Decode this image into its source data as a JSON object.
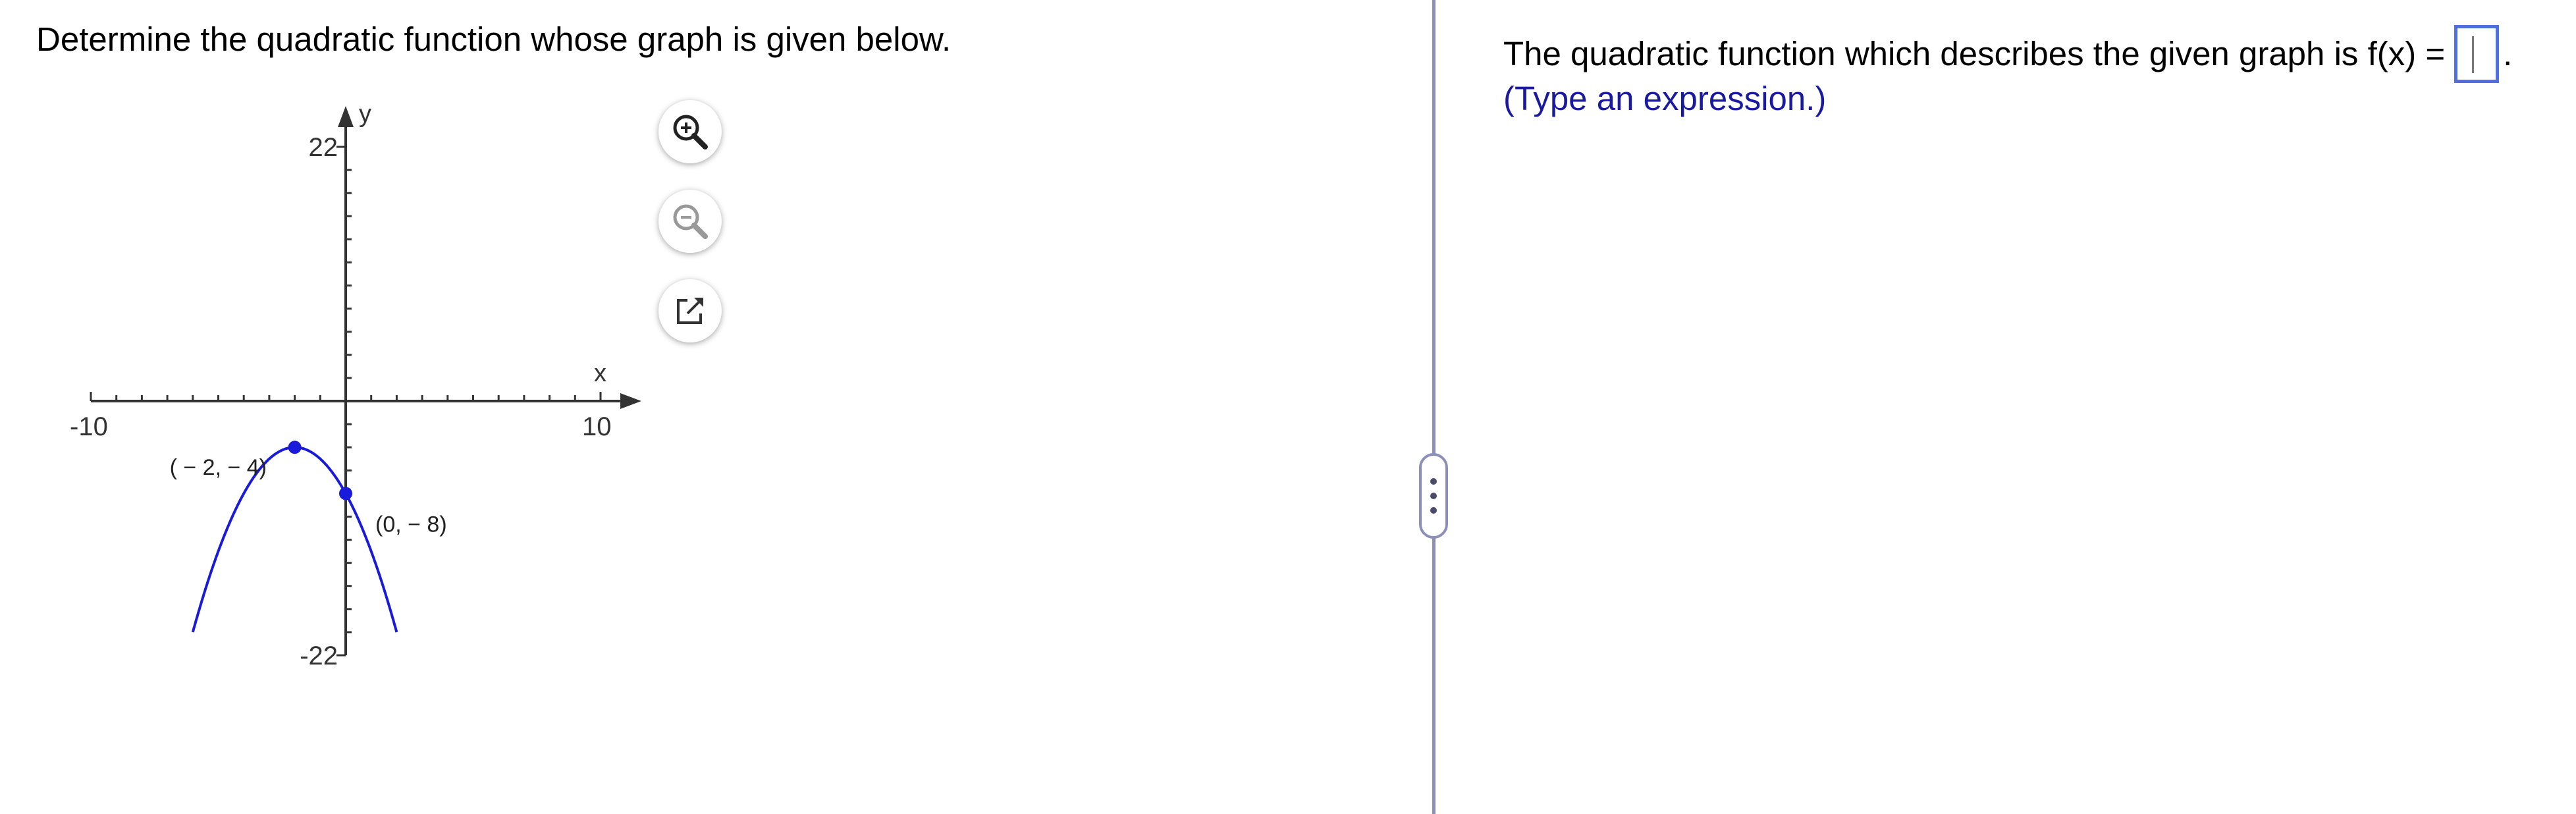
{
  "left_panel": {
    "prompt": "Determine the quadratic function whose graph is given below."
  },
  "graph": {
    "axis_labels": {
      "x": "x",
      "y": "y"
    },
    "tick_labels": {
      "x_min": "-10",
      "x_max": "10",
      "y_max": "22",
      "y_min": "-22"
    },
    "points": [
      {
        "label": "( − 2, − 4)",
        "x": -2,
        "y": -4
      },
      {
        "label": "(0, − 8)",
        "x": 0,
        "y": -8
      }
    ],
    "curve": {
      "type": "parabola",
      "vertex": [
        -2,
        -4
      ],
      "through": [
        0,
        -8
      ],
      "color": "#1a1adb"
    },
    "x_range": [
      -10,
      10
    ],
    "y_range": [
      -22,
      22
    ]
  },
  "tools": [
    {
      "name": "zoom-in",
      "icon": "zoom-in-icon"
    },
    {
      "name": "zoom-out",
      "icon": "zoom-out-icon"
    },
    {
      "name": "open-new-window",
      "icon": "external-link-icon"
    }
  ],
  "right_panel": {
    "question": "The quadratic function which describes the given graph is f(x) =",
    "question_end": ".",
    "hint": "(Type an expression.)"
  },
  "colors": {
    "accent": "#4f6fe0",
    "divider": "#8c8fb8",
    "hint": "#1a1aa0",
    "curve": "#1a1adb"
  }
}
